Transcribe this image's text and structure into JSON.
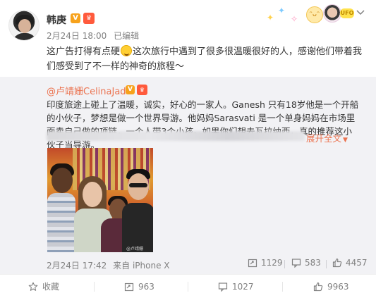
{
  "post": {
    "author": "韩庚",
    "verified_badge": "V",
    "vip_badge": "♛",
    "date": "2月24日 18:00",
    "edited": "已编辑",
    "text_part1": "这广告打得有点硬",
    "text_part2": "这次旅行中遇到了很多很温暖很好的人，感谢他们带着我们感受到了不一样的神奇的旅程～"
  },
  "header_deco": {
    "tag_text": "UFO"
  },
  "repost": {
    "author": "@卢靖姗CelinaJade",
    "verified_badge": "V",
    "vip_badge": "♛",
    "text": "印度旅途上碰上了温暖，诚实，好心的一家人。Ganesh 只有18岁他是一个开船的小伙子，梦想是做一个世界导游。他妈妈Sarasvati 是一个单身妈妈在市场里面卖自己做的项链，一个人带3个小孩。如果你们想去瓦拉纳西，真的推荐这小伙子当导游。",
    "expand_label": "展开全文",
    "expand_icon": "chevron-down",
    "photo_watermark": "@卢靖姗",
    "meta_date": "2月24日 17:42",
    "meta_from": "来自 iPhone X",
    "forward_count": "1129",
    "comment_count": "583",
    "like_count": "4457"
  },
  "footer": {
    "favorite_label": "收藏",
    "forward_count": "963",
    "comment_count": "1027",
    "like_count": "9963"
  },
  "colors": {
    "accent_link": "#eb7350",
    "repost_bg": "#f2f2f5",
    "verified": "#f7a21b",
    "muted_text": "#808080"
  }
}
